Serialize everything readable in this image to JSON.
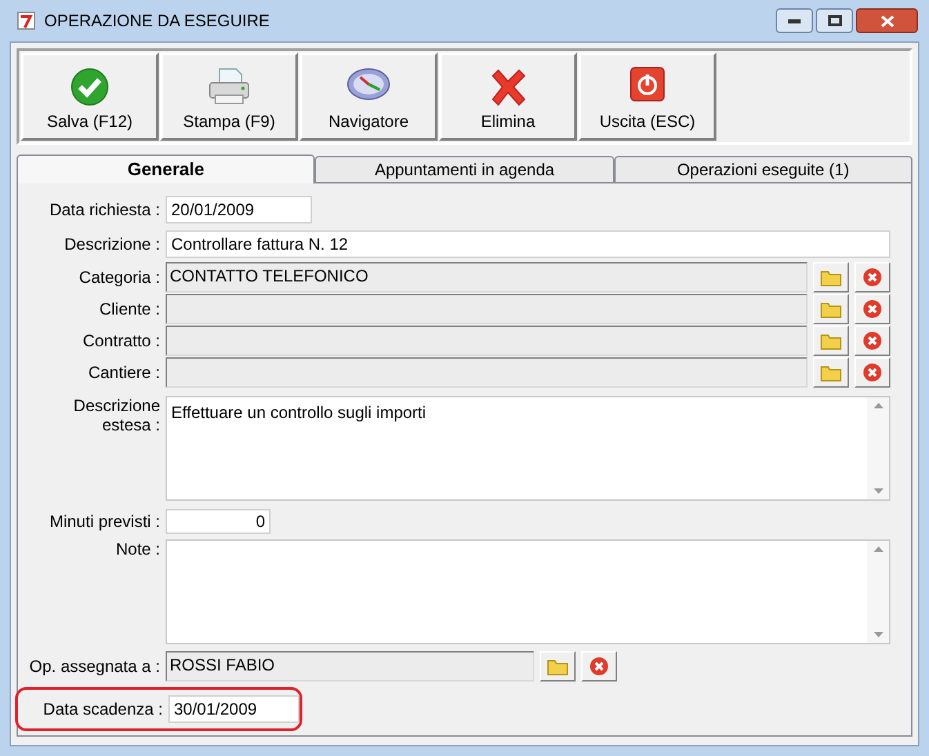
{
  "window": {
    "title": "OPERAZIONE DA ESEGUIRE"
  },
  "toolbar": [
    {
      "label": "Salva (F12)",
      "kind": "save"
    },
    {
      "label": "Stampa (F9)",
      "kind": "print"
    },
    {
      "label": "Navigatore",
      "kind": "compass"
    },
    {
      "label": "Elimina",
      "kind": "delete"
    },
    {
      "label": "Uscita (ESC)",
      "kind": "exit"
    }
  ],
  "tabs": [
    {
      "label": "Generale",
      "selected": true
    },
    {
      "label": "Appuntamenti in agenda",
      "selected": false
    },
    {
      "label": "Operazioni eseguite (1)",
      "selected": false
    }
  ],
  "fields": [
    {
      "label": "Data richiesta :",
      "kind": "date",
      "value": "20/01/2009",
      "highlighted": false
    },
    {
      "label": "Descrizione :",
      "kind": "text",
      "value": "Controllare fattura N. 12",
      "highlighted": false
    },
    {
      "label": "Categoria :",
      "kind": "lookup",
      "value": "CONTATTO TELEFONICO",
      "highlighted": false
    },
    {
      "label": "Cliente :",
      "kind": "lookup",
      "highlighted": false
    },
    {
      "label": "Contratto :",
      "kind": "lookup",
      "highlighted": false
    },
    {
      "label": "Cantiere :",
      "kind": "lookup",
      "highlighted": false
    },
    {
      "label": "Descrizione estesa :",
      "kind": "memo",
      "value": "Effettuare un controllo sugli importi",
      "highlighted": false
    },
    {
      "label": "Minuti previsti :",
      "kind": "number",
      "value": "0",
      "highlighted": false
    },
    {
      "label": "Note :",
      "kind": "memo",
      "highlighted": false
    },
    {
      "label": "Op. assegnata a :",
      "kind": "operator",
      "value": "ROSSI FABIO",
      "highlighted": false
    },
    {
      "label": "Data scadenza :",
      "kind": "date",
      "value": "30/01/2009",
      "highlighted": true
    }
  ]
}
